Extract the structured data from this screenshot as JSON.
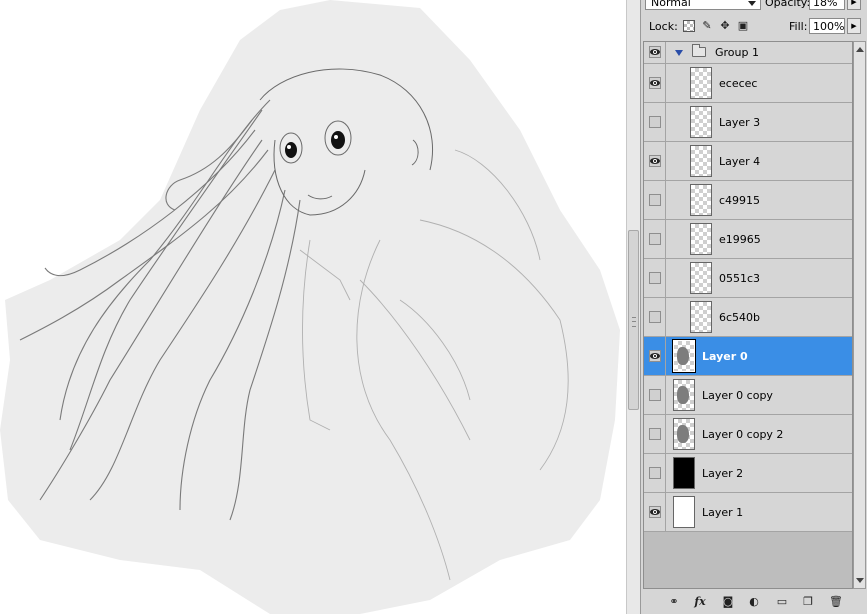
{
  "layers_panel": {
    "blend_mode": "Normal",
    "opacity_label": "Opacity:",
    "opacity_value": "18%",
    "lock_label": "Lock:",
    "fill_label": "Fill:",
    "fill_value": "100%",
    "group_name": "Group 1",
    "layers": [
      {
        "name": "ececec",
        "visible": true,
        "thumb": "transparent"
      },
      {
        "name": "Layer 3",
        "visible": false,
        "thumb": "transparent"
      },
      {
        "name": "Layer 4",
        "visible": true,
        "thumb": "transparent"
      },
      {
        "name": "c49915",
        "visible": false,
        "thumb": "transparent"
      },
      {
        "name": "e19965",
        "visible": false,
        "thumb": "transparent"
      },
      {
        "name": "0551c3",
        "visible": false,
        "thumb": "transparent"
      },
      {
        "name": "6c540b",
        "visible": false,
        "thumb": "transparent"
      },
      {
        "name": "Layer 0",
        "visible": true,
        "thumb": "sketch",
        "selected": true
      },
      {
        "name": "Layer 0 copy",
        "visible": false,
        "thumb": "sketch"
      },
      {
        "name": "Layer 0 copy 2",
        "visible": false,
        "thumb": "sketch"
      },
      {
        "name": "Layer 2",
        "visible": false,
        "thumb": "black"
      },
      {
        "name": "Layer 1",
        "visible": true,
        "thumb": "white"
      }
    ],
    "bottom_icons": [
      "link-layers-icon",
      "fx-icon",
      "mask-icon",
      "adjustment-icon",
      "new-group-icon",
      "new-layer-icon",
      "trash-icon"
    ],
    "fx_label": "fx"
  },
  "colors": {
    "selected_row": "#3a8ee6",
    "panel_bg": "#d6d6d6",
    "canvas_shape": "#ececec"
  }
}
